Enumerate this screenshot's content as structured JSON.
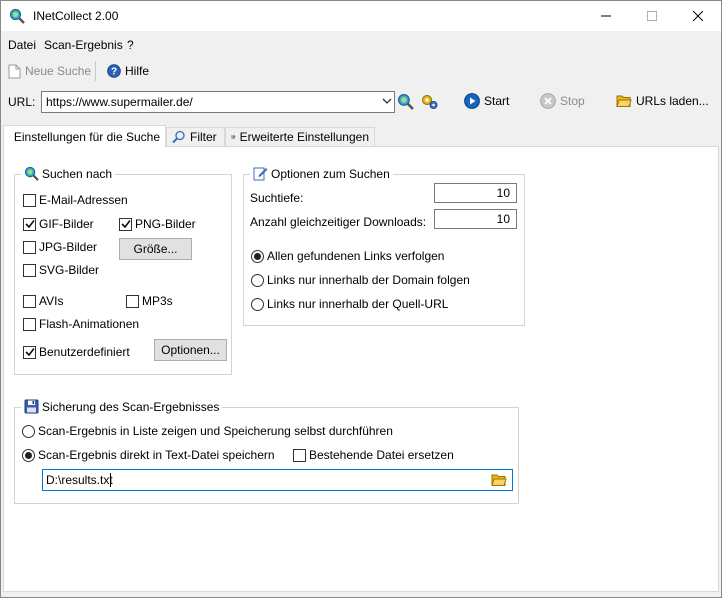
{
  "window": {
    "title": "INetCollect 2.00"
  },
  "menu": [
    "Datei",
    "Scan-Ergebnis",
    "?"
  ],
  "toolbar": {
    "new_search": "Neue Suche",
    "help": "Hilfe"
  },
  "url_bar": {
    "label": "URL:",
    "value": "https://www.supermailer.de/",
    "start": "Start",
    "stop": "Stop",
    "load_urls": "URLs laden..."
  },
  "tabs": [
    "Einstellungen für die Suche",
    "Filter",
    "Erweiterte Einstellungen"
  ],
  "search_for": {
    "title": "Suchen nach",
    "email": {
      "label": "E-Mail-Adressen",
      "checked": false
    },
    "gif": {
      "label": "GIF-Bilder",
      "checked": true
    },
    "png": {
      "label": "PNG-Bilder",
      "checked": true
    },
    "jpg": {
      "label": "JPG-Bilder",
      "checked": false
    },
    "size_button": "Größe...",
    "svg": {
      "label": "SVG-Bilder",
      "checked": false
    },
    "avi": {
      "label": "AVIs",
      "checked": false
    },
    "mp3": {
      "label": "MP3s",
      "checked": false
    },
    "flash": {
      "label": "Flash-Animationen",
      "checked": false
    },
    "custom": {
      "label": "Benutzerdefiniert",
      "checked": true
    },
    "options_button": "Optionen..."
  },
  "search_options": {
    "title": "Optionen zum Suchen",
    "depth_label": "Suchtiefe:",
    "depth_value": "10",
    "downloads_label": "Anzahl gleichzeitiger Downloads:",
    "downloads_value": "10",
    "follow_all": "Allen gefundenen Links verfolgen",
    "follow_domain": "Links nur innerhalb der Domain folgen",
    "follow_source": "Links nur innerhalb der Quell-URL",
    "selected": "follow_all"
  },
  "save": {
    "title": "Sicherung des Scan-Ergebnisses",
    "show_list": "Scan-Ergebnis in Liste zeigen und Speicherung selbst durchführen",
    "save_text": "Scan-Ergebnis direkt in Text-Datei speichern",
    "replace": {
      "label": "Bestehende Datei ersetzen",
      "checked": false
    },
    "path": "D:\\results.txt",
    "selected": "save_text"
  },
  "colors": {
    "accent": "#0078d7",
    "start_blue": "#1565c0",
    "folder": "#f4c430"
  }
}
